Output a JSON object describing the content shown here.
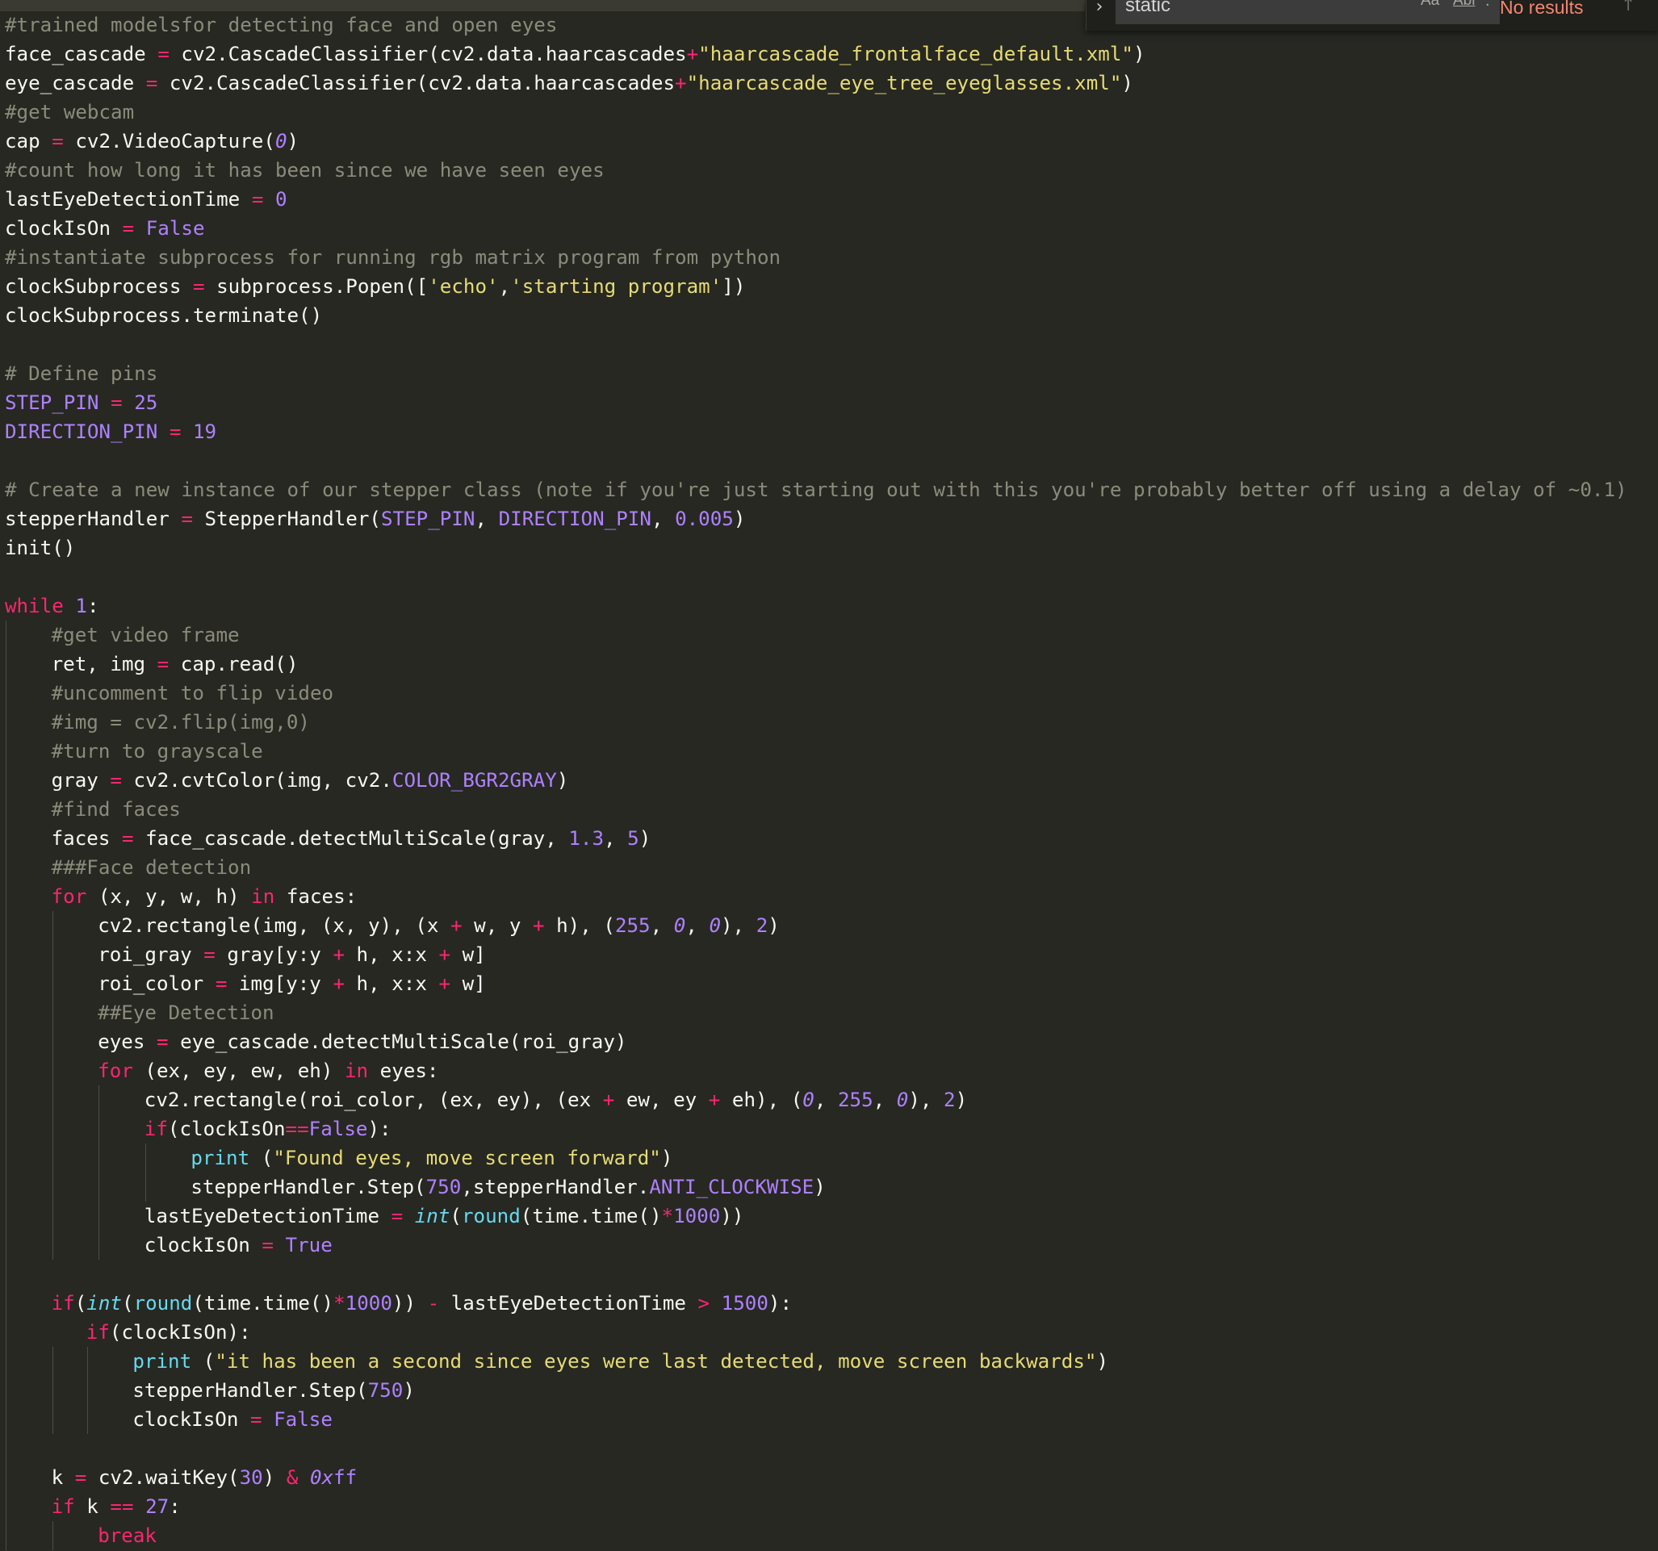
{
  "find_widget": {
    "search_value": "static",
    "match_case_label": "Aa",
    "match_word_label": "Abl",
    "regex_label": ".*",
    "results_text": "No results",
    "toggle_glyph": "›",
    "prev_glyph": "↑"
  },
  "colors": {
    "background": "#272822",
    "keyword": "#f92672",
    "string": "#e6db74",
    "number": "#ae81ff",
    "builtin": "#66d9ef",
    "comment": "#8b8b7c",
    "error_text": "#f48771"
  },
  "code": [
    {
      "indent": [],
      "tokens": [
        {
          "c": "c",
          "t": "#trained modelsfor detecting face and open eyes"
        }
      ]
    },
    {
      "indent": [],
      "tokens": [
        {
          "t": "face_cascade "
        },
        {
          "c": "o",
          "t": "="
        },
        {
          "t": " cv2.CascadeClassifier(cv2.data.haarcascades"
        },
        {
          "c": "o",
          "t": "+"
        },
        {
          "c": "s",
          "t": "\"haarcascade_frontalface_default.xml\""
        },
        {
          "t": ")"
        }
      ]
    },
    {
      "indent": [],
      "tokens": [
        {
          "t": "eye_cascade "
        },
        {
          "c": "o",
          "t": "="
        },
        {
          "t": " cv2.CascadeClassifier(cv2.data.haarcascades"
        },
        {
          "c": "o",
          "t": "+"
        },
        {
          "c": "s",
          "t": "\"haarcascade_eye_tree_eyeglasses.xml\""
        },
        {
          "t": ")"
        }
      ]
    },
    {
      "indent": [],
      "tokens": [
        {
          "c": "c",
          "t": "#get webcam"
        }
      ]
    },
    {
      "indent": [],
      "tokens": [
        {
          "t": "cap "
        },
        {
          "c": "o",
          "t": "="
        },
        {
          "t": " cv2.VideoCapture("
        },
        {
          "c": "ni",
          "t": "0"
        },
        {
          "t": ")"
        }
      ]
    },
    {
      "indent": [],
      "tokens": [
        {
          "c": "c",
          "t": "#count how long it has been since we have seen eyes"
        }
      ]
    },
    {
      "indent": [],
      "tokens": [
        {
          "t": "lastEyeDetectionTime "
        },
        {
          "c": "o",
          "t": "="
        },
        {
          "t": " "
        },
        {
          "c": "n",
          "t": "0"
        }
      ]
    },
    {
      "indent": [],
      "tokens": [
        {
          "t": "clockIsOn "
        },
        {
          "c": "o",
          "t": "="
        },
        {
          "t": " "
        },
        {
          "c": "n",
          "t": "False"
        }
      ]
    },
    {
      "indent": [],
      "tokens": [
        {
          "c": "c",
          "t": "#instantiate subprocess for running rgb matrix program from python"
        }
      ]
    },
    {
      "indent": [],
      "tokens": [
        {
          "t": "clockSubprocess "
        },
        {
          "c": "o",
          "t": "="
        },
        {
          "t": " subprocess.Popen(["
        },
        {
          "c": "s",
          "t": "'echo'"
        },
        {
          "t": ","
        },
        {
          "c": "s",
          "t": "'starting program'"
        },
        {
          "t": "])"
        }
      ]
    },
    {
      "indent": [],
      "tokens": [
        {
          "t": "clockSubprocess.terminate()"
        }
      ]
    },
    {
      "indent": [],
      "tokens": []
    },
    {
      "indent": [],
      "tokens": [
        {
          "c": "c",
          "t": "# Define pins"
        }
      ]
    },
    {
      "indent": [],
      "tokens": [
        {
          "c": "n",
          "t": "STEP_PIN"
        },
        {
          "t": " "
        },
        {
          "c": "o",
          "t": "="
        },
        {
          "t": " "
        },
        {
          "c": "n",
          "t": "25"
        }
      ]
    },
    {
      "indent": [],
      "tokens": [
        {
          "c": "n",
          "t": "DIRECTION_PIN"
        },
        {
          "t": " "
        },
        {
          "c": "o",
          "t": "="
        },
        {
          "t": " "
        },
        {
          "c": "n",
          "t": "19"
        }
      ]
    },
    {
      "indent": [],
      "tokens": []
    },
    {
      "indent": [],
      "tokens": [
        {
          "c": "c",
          "t": "# Create a new instance of our stepper class (note if you're just starting out with this you're probably better off using a delay of ~0.1)"
        }
      ]
    },
    {
      "indent": [],
      "tokens": [
        {
          "t": "stepperHandler "
        },
        {
          "c": "o",
          "t": "="
        },
        {
          "t": " StepperHandler("
        },
        {
          "c": "n",
          "t": "STEP_PIN"
        },
        {
          "t": ", "
        },
        {
          "c": "n",
          "t": "DIRECTION_PIN"
        },
        {
          "t": ", "
        },
        {
          "c": "n",
          "t": "0.005"
        },
        {
          "t": ")"
        }
      ]
    },
    {
      "indent": [],
      "tokens": [
        {
          "t": "init()"
        }
      ]
    },
    {
      "indent": [],
      "tokens": []
    },
    {
      "indent": [],
      "tokens": [
        {
          "c": "k",
          "t": "while"
        },
        {
          "t": " "
        },
        {
          "c": "n",
          "t": "1"
        },
        {
          "t": ":"
        }
      ]
    },
    {
      "indent": [
        "g"
      ],
      "tokens": [
        {
          "c": "c",
          "t": "#get video frame"
        }
      ]
    },
    {
      "indent": [
        "g"
      ],
      "tokens": [
        {
          "t": "ret, img "
        },
        {
          "c": "o",
          "t": "="
        },
        {
          "t": " cap.read()"
        }
      ]
    },
    {
      "indent": [
        "g"
      ],
      "tokens": [
        {
          "c": "c",
          "t": "#uncomment to flip video"
        }
      ]
    },
    {
      "indent": [
        "g"
      ],
      "tokens": [
        {
          "c": "c",
          "t": "#img = cv2.flip(img,0)"
        }
      ]
    },
    {
      "indent": [
        "g"
      ],
      "tokens": [
        {
          "c": "c",
          "t": "#turn to grayscale"
        }
      ]
    },
    {
      "indent": [
        "g"
      ],
      "tokens": [
        {
          "t": "gray "
        },
        {
          "c": "o",
          "t": "="
        },
        {
          "t": " cv2.cvtColor(img, cv2."
        },
        {
          "c": "n",
          "t": "COLOR_BGR2GRAY"
        },
        {
          "t": ")"
        }
      ]
    },
    {
      "indent": [
        "g"
      ],
      "tokens": [
        {
          "c": "c",
          "t": "#find faces"
        }
      ]
    },
    {
      "indent": [
        "g"
      ],
      "tokens": [
        {
          "t": "faces "
        },
        {
          "c": "o",
          "t": "="
        },
        {
          "t": " face_cascade.detectMultiScale(gray, "
        },
        {
          "c": "n",
          "t": "1.3"
        },
        {
          "t": ", "
        },
        {
          "c": "n",
          "t": "5"
        },
        {
          "t": ")"
        }
      ]
    },
    {
      "indent": [
        "g"
      ],
      "tokens": [
        {
          "c": "c",
          "t": "###Face detection"
        }
      ]
    },
    {
      "indent": [
        "g"
      ],
      "tokens": [
        {
          "c": "k",
          "t": "for"
        },
        {
          "t": " (x, y, w, h) "
        },
        {
          "c": "k",
          "t": "in"
        },
        {
          "t": " faces:"
        }
      ]
    },
    {
      "indent": [
        "g",
        "g"
      ],
      "tokens": [
        {
          "t": "cv2.rectangle(img, (x, y), (x "
        },
        {
          "c": "o",
          "t": "+"
        },
        {
          "t": " w, y "
        },
        {
          "c": "o",
          "t": "+"
        },
        {
          "t": " h), ("
        },
        {
          "c": "n",
          "t": "255"
        },
        {
          "t": ", "
        },
        {
          "c": "ni",
          "t": "0"
        },
        {
          "t": ", "
        },
        {
          "c": "ni",
          "t": "0"
        },
        {
          "t": "), "
        },
        {
          "c": "n",
          "t": "2"
        },
        {
          "t": ")"
        }
      ]
    },
    {
      "indent": [
        "g",
        "g"
      ],
      "tokens": [
        {
          "t": "roi_gray "
        },
        {
          "c": "o",
          "t": "="
        },
        {
          "t": " gray[y:y "
        },
        {
          "c": "o",
          "t": "+"
        },
        {
          "t": " h, x:x "
        },
        {
          "c": "o",
          "t": "+"
        },
        {
          "t": " w]"
        }
      ]
    },
    {
      "indent": [
        "g",
        "g"
      ],
      "tokens": [
        {
          "t": "roi_color "
        },
        {
          "c": "o",
          "t": "="
        },
        {
          "t": " img[y:y "
        },
        {
          "c": "o",
          "t": "+"
        },
        {
          "t": " h, x:x "
        },
        {
          "c": "o",
          "t": "+"
        },
        {
          "t": " w]"
        }
      ]
    },
    {
      "indent": [
        "g",
        "g"
      ],
      "tokens": [
        {
          "c": "c",
          "t": "##Eye Detection"
        }
      ]
    },
    {
      "indent": [
        "g",
        "g"
      ],
      "tokens": [
        {
          "t": "eyes "
        },
        {
          "c": "o",
          "t": "="
        },
        {
          "t": " eye_cascade.detectMultiScale(roi_gray)"
        }
      ]
    },
    {
      "indent": [
        "g",
        "g"
      ],
      "tokens": [
        {
          "c": "k",
          "t": "for"
        },
        {
          "t": " (ex, ey, ew, eh) "
        },
        {
          "c": "k",
          "t": "in"
        },
        {
          "t": " eyes:"
        }
      ]
    },
    {
      "indent": [
        "g",
        "g",
        "g"
      ],
      "tokens": [
        {
          "t": "cv2.rectangle(roi_color, (ex, ey), (ex "
        },
        {
          "c": "o",
          "t": "+"
        },
        {
          "t": " ew, ey "
        },
        {
          "c": "o",
          "t": "+"
        },
        {
          "t": " eh), ("
        },
        {
          "c": "ni",
          "t": "0"
        },
        {
          "t": ", "
        },
        {
          "c": "n",
          "t": "255"
        },
        {
          "t": ", "
        },
        {
          "c": "ni",
          "t": "0"
        },
        {
          "t": "), "
        },
        {
          "c": "n",
          "t": "2"
        },
        {
          "t": ")"
        }
      ]
    },
    {
      "indent": [
        "g",
        "g",
        "g"
      ],
      "tokens": [
        {
          "c": "k",
          "t": "if"
        },
        {
          "t": "(clockIsOn"
        },
        {
          "c": "o",
          "t": "=="
        },
        {
          "c": "n",
          "t": "False"
        },
        {
          "t": "):"
        }
      ]
    },
    {
      "indent": [
        "g",
        "g",
        "g",
        "g"
      ],
      "tokens": [
        {
          "c": "b",
          "t": "print"
        },
        {
          "t": " ("
        },
        {
          "c": "s",
          "t": "\"Found eyes, move screen forward\""
        },
        {
          "t": ")"
        }
      ]
    },
    {
      "indent": [
        "g",
        "g",
        "g",
        "g"
      ],
      "tokens": [
        {
          "t": "stepperHandler.Step("
        },
        {
          "c": "n",
          "t": "750"
        },
        {
          "t": ",stepperHandler."
        },
        {
          "c": "n",
          "t": "ANTI_CLOCKWISE"
        },
        {
          "t": ")"
        }
      ]
    },
    {
      "indent": [
        "g",
        "g",
        "g"
      ],
      "tokens": [
        {
          "t": "lastEyeDetectionTime "
        },
        {
          "c": "o",
          "t": "="
        },
        {
          "t": " "
        },
        {
          "c": "bi",
          "t": "int"
        },
        {
          "t": "("
        },
        {
          "c": "b",
          "t": "round"
        },
        {
          "t": "(time.time()"
        },
        {
          "c": "o",
          "t": "*"
        },
        {
          "c": "n",
          "t": "1000"
        },
        {
          "t": "))"
        }
      ]
    },
    {
      "indent": [
        "g",
        "g",
        "g"
      ],
      "tokens": [
        {
          "t": "clockIsOn "
        },
        {
          "c": "o",
          "t": "="
        },
        {
          "t": " "
        },
        {
          "c": "n",
          "t": "True"
        }
      ]
    },
    {
      "indent": [
        "g"
      ],
      "tokens": []
    },
    {
      "indent": [
        "g"
      ],
      "tokens": [
        {
          "c": "k",
          "t": "if"
        },
        {
          "t": "("
        },
        {
          "c": "bi",
          "t": "int"
        },
        {
          "t": "("
        },
        {
          "c": "b",
          "t": "round"
        },
        {
          "t": "(time.time()"
        },
        {
          "c": "o",
          "t": "*"
        },
        {
          "c": "n",
          "t": "1000"
        },
        {
          "t": ")) "
        },
        {
          "c": "o",
          "t": "-"
        },
        {
          "t": " lastEyeDetectionTime "
        },
        {
          "c": "o",
          "t": ">"
        },
        {
          "t": " "
        },
        {
          "c": "n",
          "t": "1500"
        },
        {
          "t": "):"
        }
      ]
    },
    {
      "indent": [
        "g",
        "sm-nb"
      ],
      "tokens": [
        {
          "c": "k",
          "t": "if"
        },
        {
          "t": "(clockIsOn):"
        }
      ]
    },
    {
      "indent": [
        "g",
        "sm",
        "g"
      ],
      "tokens": [
        {
          "c": "b",
          "t": "print"
        },
        {
          "t": " ("
        },
        {
          "c": "s",
          "t": "\"it has been a second since eyes were last detected, move screen backwards\""
        },
        {
          "t": ")"
        }
      ]
    },
    {
      "indent": [
        "g",
        "sm",
        "g"
      ],
      "tokens": [
        {
          "t": "stepperHandler.Step("
        },
        {
          "c": "n",
          "t": "750"
        },
        {
          "t": ")"
        }
      ]
    },
    {
      "indent": [
        "g",
        "sm",
        "g"
      ],
      "tokens": [
        {
          "t": "clockIsOn "
        },
        {
          "c": "o",
          "t": "="
        },
        {
          "t": " "
        },
        {
          "c": "n",
          "t": "False"
        }
      ]
    },
    {
      "indent": [
        "g"
      ],
      "tokens": []
    },
    {
      "indent": [
        "g"
      ],
      "tokens": [
        {
          "t": "k "
        },
        {
          "c": "o",
          "t": "="
        },
        {
          "t": " cv2.waitKey("
        },
        {
          "c": "n",
          "t": "30"
        },
        {
          "t": ") "
        },
        {
          "c": "o",
          "t": "&"
        },
        {
          "t": " "
        },
        {
          "c": "ni",
          "t": "0x"
        },
        {
          "c": "n",
          "t": "ff"
        }
      ]
    },
    {
      "indent": [
        "g"
      ],
      "tokens": [
        {
          "c": "k",
          "t": "if"
        },
        {
          "t": " k "
        },
        {
          "c": "o",
          "t": "=="
        },
        {
          "t": " "
        },
        {
          "c": "n",
          "t": "27"
        },
        {
          "t": ":"
        }
      ]
    },
    {
      "indent": [
        "g",
        "g"
      ],
      "tokens": [
        {
          "c": "k",
          "t": "break"
        }
      ]
    }
  ]
}
